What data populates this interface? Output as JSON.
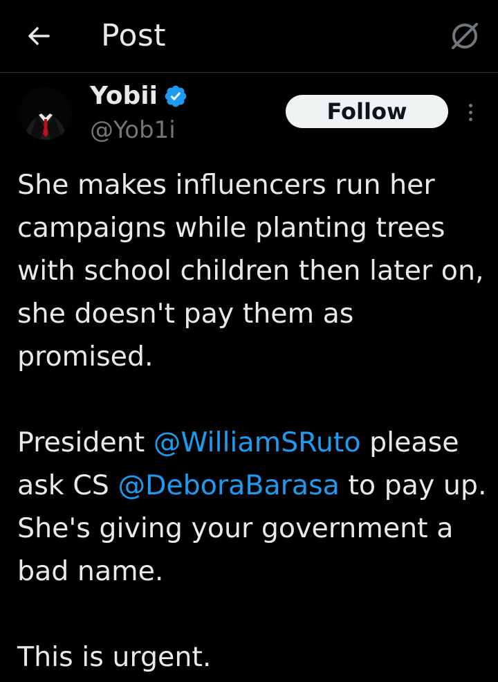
{
  "header": {
    "back_icon": "arrow-left-icon",
    "title": "Post",
    "grok_icon": "grok-slash-icon"
  },
  "author": {
    "name": "Yobii",
    "handle": "@Yob1i",
    "verified": true,
    "verified_color": "#1d9bf0",
    "avatar_icon": "avatar-suit-icon"
  },
  "follow_button": {
    "label": "Follow"
  },
  "more_icon": "more-vertical-icon",
  "post": {
    "p1": "She makes influencers run her campaigns while planting trees with school children then later on, she doesn't pay them as promised.",
    "p2_part1": "President ",
    "mention1": "@WilliamSRuto",
    "p2_part2": " please ask CS ",
    "mention2": "@DeboraBarasa",
    "p2_part3": " to pay up. She's giving your government a bad name.",
    "p3": "This is urgent."
  },
  "colors": {
    "background": "#000000",
    "text": "#e7e9ea",
    "secondary": "#71767b",
    "accent": "#1d9bf0"
  }
}
